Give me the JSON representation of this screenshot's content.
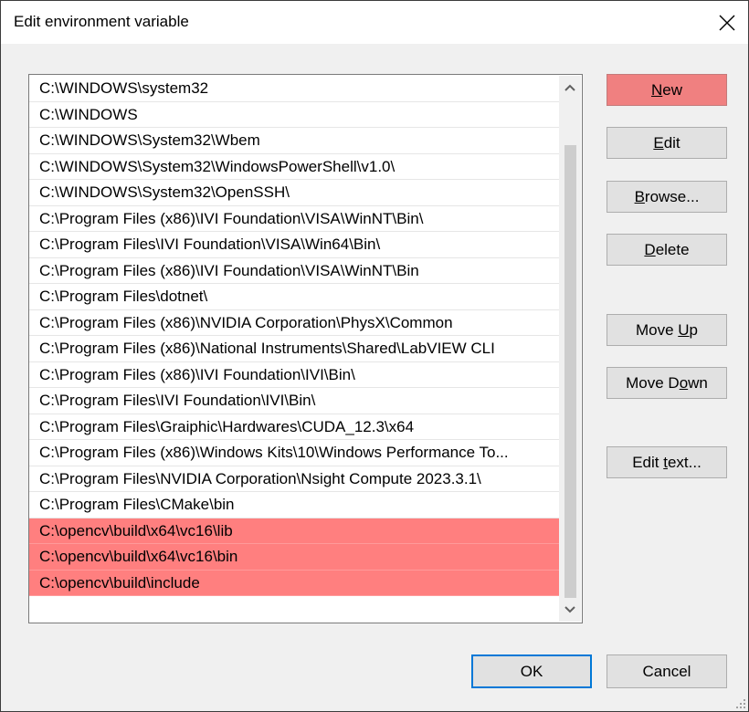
{
  "window": {
    "title": "Edit environment variable",
    "close_icon": "close-icon"
  },
  "path_list": {
    "items": [
      {
        "text": "C:\\WINDOWS\\system32",
        "highlighted": false
      },
      {
        "text": "C:\\WINDOWS",
        "highlighted": false
      },
      {
        "text": "C:\\WINDOWS\\System32\\Wbem",
        "highlighted": false
      },
      {
        "text": "C:\\WINDOWS\\System32\\WindowsPowerShell\\v1.0\\",
        "highlighted": false
      },
      {
        "text": "C:\\WINDOWS\\System32\\OpenSSH\\",
        "highlighted": false
      },
      {
        "text": "C:\\Program Files (x86)\\IVI Foundation\\VISA\\WinNT\\Bin\\",
        "highlighted": false
      },
      {
        "text": "C:\\Program Files\\IVI Foundation\\VISA\\Win64\\Bin\\",
        "highlighted": false
      },
      {
        "text": "C:\\Program Files (x86)\\IVI Foundation\\VISA\\WinNT\\Bin",
        "highlighted": false
      },
      {
        "text": "C:\\Program Files\\dotnet\\",
        "highlighted": false
      },
      {
        "text": "C:\\Program Files (x86)\\NVIDIA Corporation\\PhysX\\Common",
        "highlighted": false
      },
      {
        "text": "C:\\Program Files (x86)\\National Instruments\\Shared\\LabVIEW CLI",
        "highlighted": false
      },
      {
        "text": "C:\\Program Files (x86)\\IVI Foundation\\IVI\\Bin\\",
        "highlighted": false
      },
      {
        "text": "C:\\Program Files\\IVI Foundation\\IVI\\Bin\\",
        "highlighted": false
      },
      {
        "text": "C:\\Program Files\\Graiphic\\Hardwares\\CUDA_12.3\\x64",
        "highlighted": false
      },
      {
        "text": "C:\\Program Files (x86)\\Windows Kits\\10\\Windows Performance To...",
        "highlighted": false
      },
      {
        "text": "C:\\Program Files\\NVIDIA Corporation\\Nsight Compute 2023.3.1\\",
        "highlighted": false
      },
      {
        "text": "C:\\Program Files\\CMake\\bin",
        "highlighted": false
      },
      {
        "text": "C:\\opencv\\build\\x64\\vc16\\lib",
        "highlighted": true
      },
      {
        "text": "C:\\opencv\\build\\x64\\vc16\\bin",
        "highlighted": true
      },
      {
        "text": "C:\\opencv\\build\\include",
        "highlighted": true
      }
    ],
    "highlight_color": "#ff7f7f"
  },
  "buttons": {
    "new": {
      "before": "",
      "mnemonic": "N",
      "after": "ew"
    },
    "edit": {
      "before": "",
      "mnemonic": "E",
      "after": "dit"
    },
    "browse": {
      "before": "",
      "mnemonic": "B",
      "after": "rowse..."
    },
    "delete": {
      "before": "",
      "mnemonic": "D",
      "after": "elete"
    },
    "move_up": {
      "before": "Move ",
      "mnemonic": "U",
      "after": "p"
    },
    "move_down": {
      "before": "Move D",
      "mnemonic": "o",
      "after": "wn"
    },
    "edit_text": {
      "before": "Edit ",
      "mnemonic": "t",
      "after": "ext..."
    },
    "ok": "OK",
    "cancel": "Cancel"
  },
  "colors": {
    "new_button_bg": "#f08080",
    "ok_focus_border": "#0078d7"
  }
}
